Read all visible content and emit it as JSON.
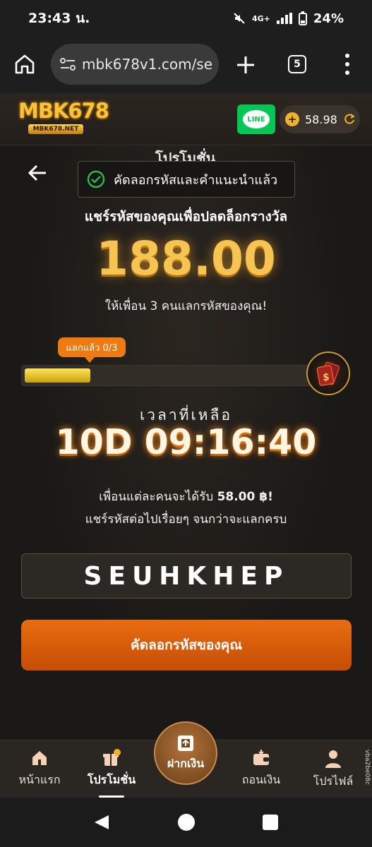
{
  "status_bar": {
    "time": "23:43 น.",
    "network": "4G+",
    "battery": "24%"
  },
  "browser": {
    "url": "mbk678v1.com/se",
    "tab_count": "5"
  },
  "header": {
    "logo_text": "MBK678",
    "logo_sub": "MBK678.NET",
    "line_label": "LINE",
    "balance": "58.98"
  },
  "page": {
    "title": "โปรโมชั่น",
    "toast": "คัดลอกรหัสและคำแนะนำแล้ว",
    "share_title": "แชร์รหัสของคุณเพื่อปลดล็อกรางวัล",
    "reward_amount": "188.00",
    "invite_text": "ให้เพื่อน 3 คนแลกรหัสของคุณ!",
    "redeemed_badge": "แลกแล้ว 0/3",
    "progress_fraction": 0.22,
    "time_remaining_label": "เวลาที่เหลือ",
    "countdown": "10D 09:16:40",
    "info_line1_prefix": "เพื่อนแต่ละคนจะได้รับ",
    "info_line1_amount": "58.00 ฿!",
    "info_line2": "แชร์รหัสต่อไปเรื่อยๆ จนกว่าจะแลกครบ",
    "code": "SEUHKHEP",
    "copy_button": "คัดลอกรหัสของคุณ"
  },
  "bottom_nav": {
    "items": [
      {
        "label": "หน้าแรก",
        "icon": "home-icon"
      },
      {
        "label": "โปรโมชั่น",
        "icon": "gift-icon",
        "active": true
      },
      {
        "label": "ฝากเงิน",
        "icon": "deposit-icon"
      },
      {
        "label": "ถอนเงิน",
        "icon": "wallet-icon"
      },
      {
        "label": "โปรไฟล์",
        "icon": "user-icon"
      }
    ],
    "side_tag": "vba2be08c"
  },
  "colors": {
    "accent_orange": "#e86d10",
    "gold": "#f6c453",
    "background": "#1a1816"
  }
}
